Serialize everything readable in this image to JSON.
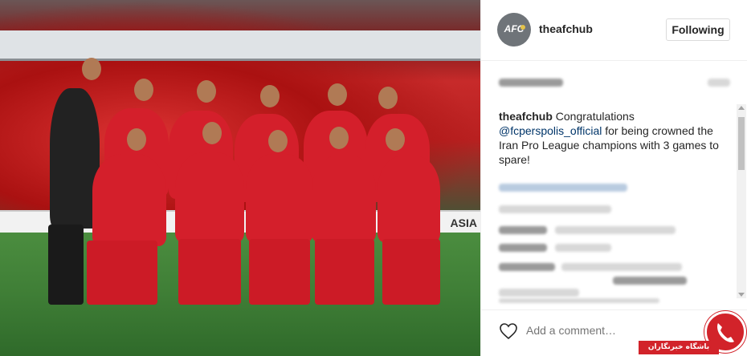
{
  "post": {
    "photo_alt": "Persepolis team photo",
    "ad_text": "ASIA"
  },
  "header": {
    "avatar_text": "AFC",
    "username": "theafchub",
    "follow_label": "Following"
  },
  "caption": {
    "username": "theafchub",
    "text_before": " Congratulations",
    "mention": "@fcperspolis_official",
    "text_after": " for being crowned the Iran Pro League champions with 3 games to spare!"
  },
  "comment": {
    "placeholder": "Add a comment…"
  },
  "watermark": {
    "label": "باشگاه خبرنگاران"
  },
  "colors": {
    "mention": "#003569",
    "watermark_red": "#d2232a",
    "kit_red": "#d41f2b"
  },
  "icons": {
    "like": "heart-icon",
    "watermark_logo": "phone-icon"
  }
}
